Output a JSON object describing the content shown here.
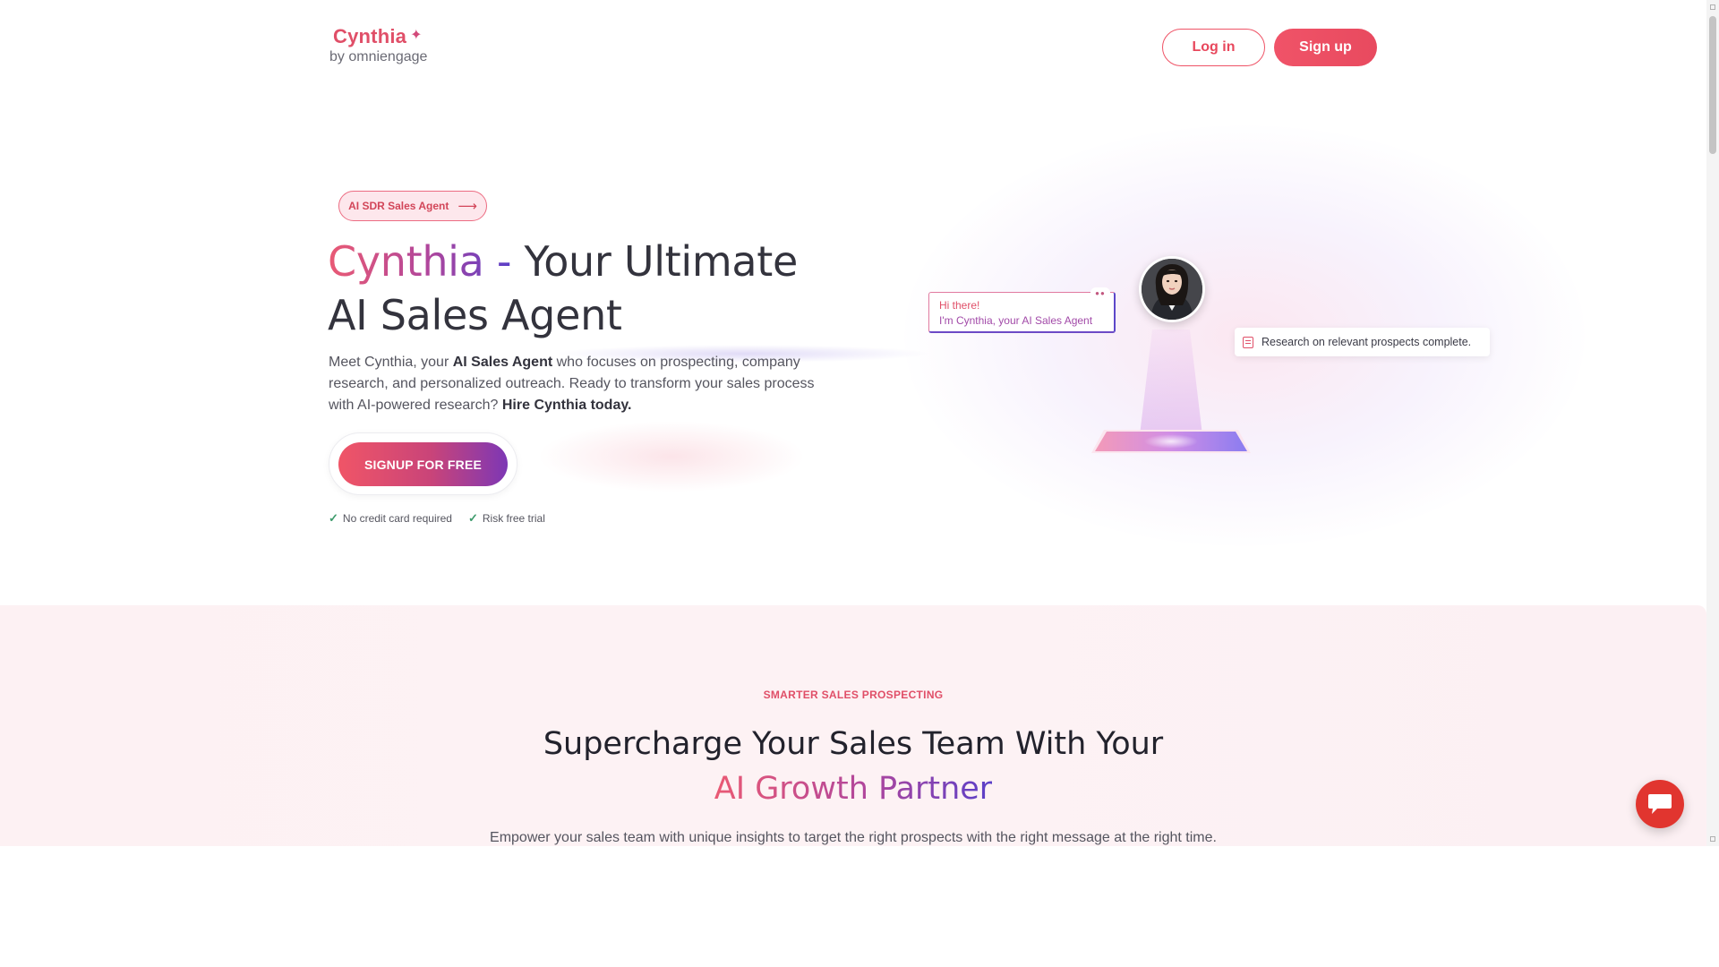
{
  "header": {
    "logo_name": "Cynthia",
    "logo_sub": "by omniengage",
    "login_label": "Log in",
    "signup_label": "Sign up"
  },
  "hero": {
    "pill_label": "AI SDR Sales Agent",
    "title_highlight": "Cynthia -",
    "title_rest_line1": " Your Ultimate",
    "title_line2": "AI Sales Agent",
    "desc_part1": "Meet Cynthia, your ",
    "desc_bold1": "AI Sales Agent",
    "desc_part2": " who focuses on prospecting, company research, and personalized outreach. Ready to transform your sales process with AI-powered research? ",
    "desc_bold2": "Hire Cynthia today.",
    "cta_label": "SIGNUP FOR FREE",
    "checks": [
      "No credit card required",
      "Risk free trial"
    ]
  },
  "illustration": {
    "chat_line1": "Hi there!",
    "chat_line2": "I'm Cynthia, your AI Sales Agent",
    "toast_text": "Research on relevant prospects complete."
  },
  "section2": {
    "kicker": "SMARTER SALES PROSPECTING",
    "title_line1": "Supercharge Your Sales Team With Your",
    "title_line2": "AI Growth Partner",
    "desc": "Empower your sales team with unique insights to target the right prospects with the right message at the right time."
  },
  "colors": {
    "brand_red": "#e8475c",
    "brand_purple": "#7d37b5",
    "chat_fab": "#e1352f"
  },
  "icons": {
    "logo_spark": "sparkle-icon",
    "pill_arrow": "arrow-right-icon",
    "check": "check-icon",
    "toast": "document-icon",
    "chat_fab": "chat-icon"
  }
}
